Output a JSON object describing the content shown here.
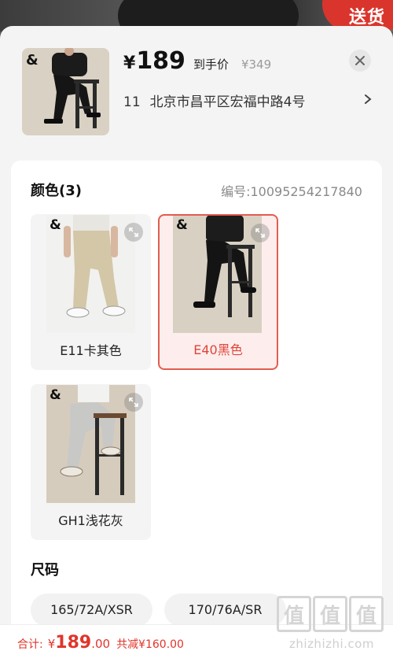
{
  "colors": {
    "accent": "#e0352b",
    "selected_border": "#e35c4e",
    "selected_bg": "#fdeeed",
    "sheet_bg": "#f4f4f4"
  },
  "backdrop": {
    "promo_badge": "送货"
  },
  "summary": {
    "price_symbol": "¥",
    "price": "189",
    "price_tag": "到手价",
    "original_price": "¥349",
    "close_icon": "close-icon",
    "address_zip": "11",
    "address": "北京市昌平区宏福中路4号",
    "address_arrow_icon": "chevron-right-icon"
  },
  "color_section": {
    "title": "颜色(3)",
    "sku": "编号:10095254217840",
    "options": [
      {
        "label": "E11卡其色",
        "selected": false,
        "image": "khaki-pants-photo"
      },
      {
        "label": "E40黑色",
        "selected": true,
        "image": "black-pants-photo"
      },
      {
        "label": "GH1浅花灰",
        "selected": false,
        "image": "grey-pants-photo"
      }
    ],
    "zoom_icon": "expand-icon"
  },
  "size_section": {
    "title": "尺码",
    "options": [
      "165/72A/XSR",
      "170/76A/SR"
    ]
  },
  "watermark": {
    "glyphs": [
      "值",
      "值",
      "值"
    ],
    "url": "zhizhizhi.com"
  },
  "footer": {
    "total_label": "合计:",
    "total_symbol": "¥",
    "total_int": "189",
    "total_dec": ".00",
    "savings": "共减¥160.00"
  }
}
